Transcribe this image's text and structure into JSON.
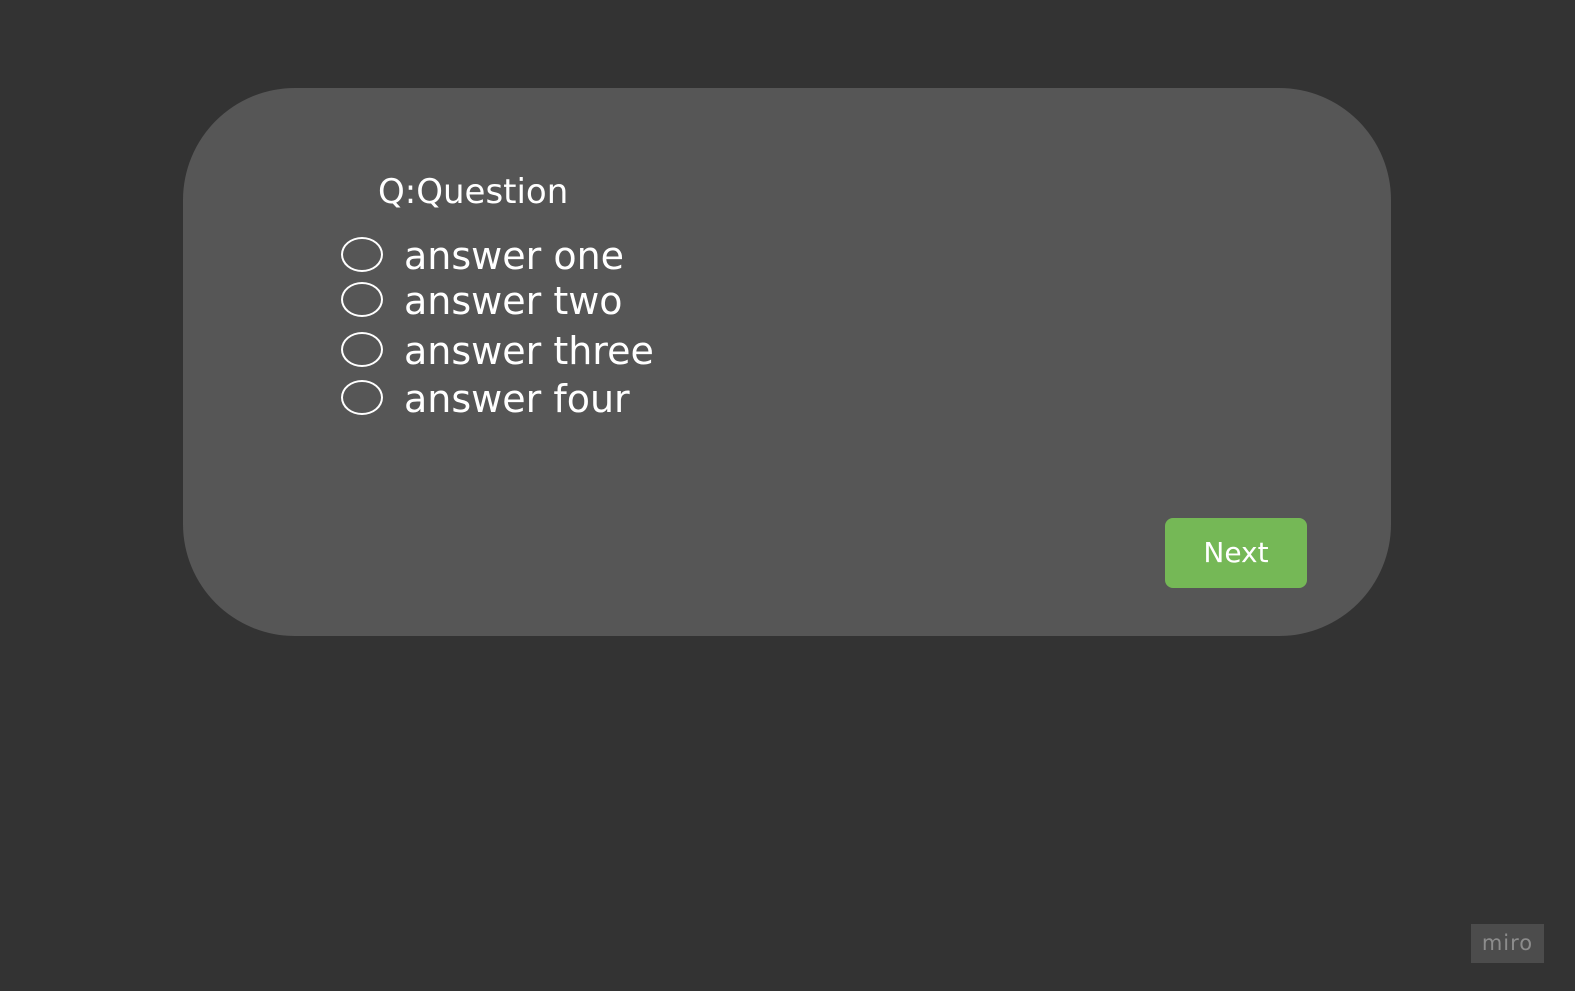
{
  "quiz": {
    "question": "Q:Question",
    "answers": [
      {
        "label": "answer one",
        "icon": "radio-unselected-icon"
      },
      {
        "label": "answer two",
        "icon": "radio-unselected-icon"
      },
      {
        "label": "answer three",
        "icon": "radio-unselected-icon"
      },
      {
        "label": "answer four",
        "icon": "radio-unselected-icon"
      }
    ],
    "next_label": "Next"
  },
  "watermark": {
    "text": "miro"
  },
  "colors": {
    "page_background": "#333333",
    "card_background": "#565656",
    "accent": "#75b856",
    "text": "#ffffff",
    "watermark_text": "#8c8c8c"
  }
}
